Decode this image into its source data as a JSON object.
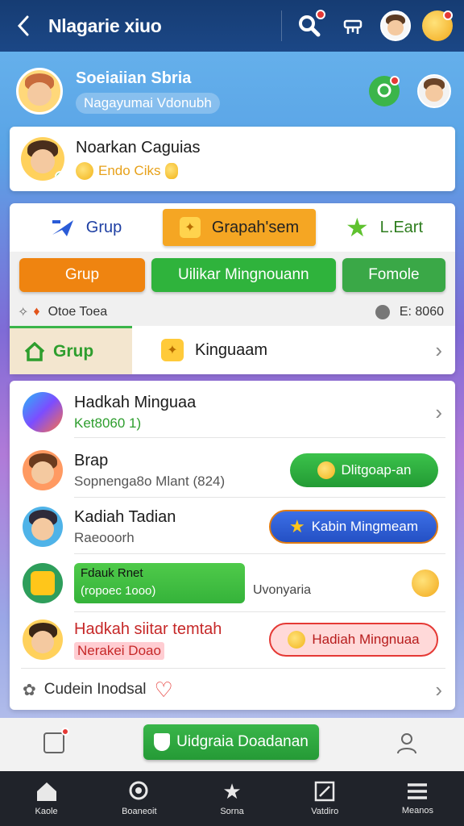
{
  "topbar": {
    "title": "Nlagarie xiuo"
  },
  "profile": {
    "name": "Soeiaiian Sbria",
    "subtitle": "Nagayumai Vdonubh"
  },
  "user_card": {
    "name": "Noarkan Caguias",
    "coins_label": "Endo Ciks"
  },
  "tabs": [
    {
      "label": "Grup",
      "icon": "plane-icon"
    },
    {
      "label": "Grapah'sem",
      "icon": "star-box-icon"
    },
    {
      "label": "L.Eart",
      "icon": "star-icon"
    }
  ],
  "buttons": [
    {
      "label": "Grup",
      "color": "#ef8410"
    },
    {
      "label": "Uilikar Mingnouann",
      "color": "#2fb33c"
    },
    {
      "label": "Fomole",
      "color": "#3aa847"
    }
  ],
  "info": {
    "left": "Otoe Toea",
    "right": "E: 8060"
  },
  "group_row": {
    "left": "Grup",
    "right": "Kinguaam"
  },
  "list": [
    {
      "title": "Hadkah Minguaa",
      "subtitle": "Ket8060 1)"
    },
    {
      "title": "Brap",
      "subtitle": "Sopnenga8o Mlant (824)",
      "action": "Dlitgoap-an"
    },
    {
      "title": "Kadiah Tadian",
      "subtitle": "Raeooorh",
      "action": "Kabin Mingmeam"
    },
    {
      "title": "Fdauk Rnet",
      "subtitle": "(ropoec 1ooo)",
      "right_text": "Uvonyaria"
    },
    {
      "title": "Hadkah siitar temtah",
      "subtitle": "Nerakei Doao",
      "action": "Hadiah Mingnuaa"
    }
  ],
  "footer_link": "Cudein Inodsal",
  "cta": "Uidgraia Doadanan",
  "nav": [
    {
      "label": "Kaole",
      "icon": "home-icon"
    },
    {
      "label": "Boaneoit",
      "icon": "search-circle-icon"
    },
    {
      "label": "Sorna",
      "icon": "star-crown-icon"
    },
    {
      "label": "Vatdiro",
      "icon": "edit-box-icon"
    },
    {
      "label": "Meanos",
      "icon": "menu-icon"
    }
  ],
  "colors": {
    "topbar": "#163c73",
    "green": "#2fb33c",
    "orange": "#f5a623",
    "blue_pill": "#2a5bd7",
    "red": "#e53935"
  }
}
